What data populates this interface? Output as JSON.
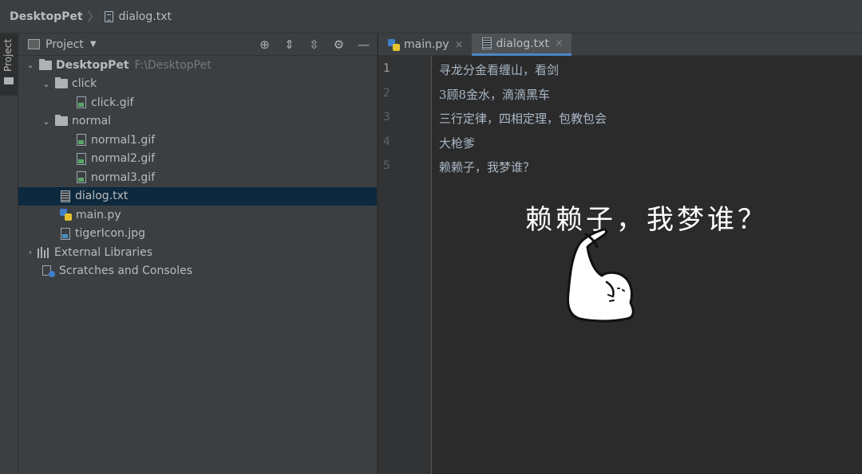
{
  "navbar": {
    "project": "DesktopPet",
    "file": "dialog.txt"
  },
  "left_stripe": {
    "tab_label": "Project"
  },
  "project_panel": {
    "title": "Project",
    "tree": {
      "root": {
        "name": "DesktopPet",
        "path": "F:\\DesktopPet"
      },
      "click_folder": "click",
      "click_gif": "click.gif",
      "normal_folder": "normal",
      "normal1": "normal1.gif",
      "normal2": "normal2.gif",
      "normal3": "normal3.gif",
      "dialog": "dialog.txt",
      "main": "main.py",
      "tiger": "tigerIcon.jpg",
      "external_libraries": "External Libraries",
      "scratches": "Scratches and Consoles"
    }
  },
  "editor": {
    "tabs": [
      {
        "label": "main.py",
        "close": "×"
      },
      {
        "label": "dialog.txt",
        "close": "×"
      }
    ],
    "line_numbers": [
      "1",
      "2",
      "3",
      "4",
      "5"
    ],
    "lines": [
      "寻龙分金看缠山，看剑",
      "3顾8金水，滴滴黑车",
      "三行定律，四相定理，包教包会",
      "大枪爹",
      "赖赖子，我梦谁？"
    ]
  },
  "meme": {
    "caption": "赖赖子，我梦谁？"
  },
  "colors": {
    "background": "#2b2b2b",
    "panel": "#3c3f41",
    "selection": "#0d293e",
    "accent": "#4a88c7"
  }
}
